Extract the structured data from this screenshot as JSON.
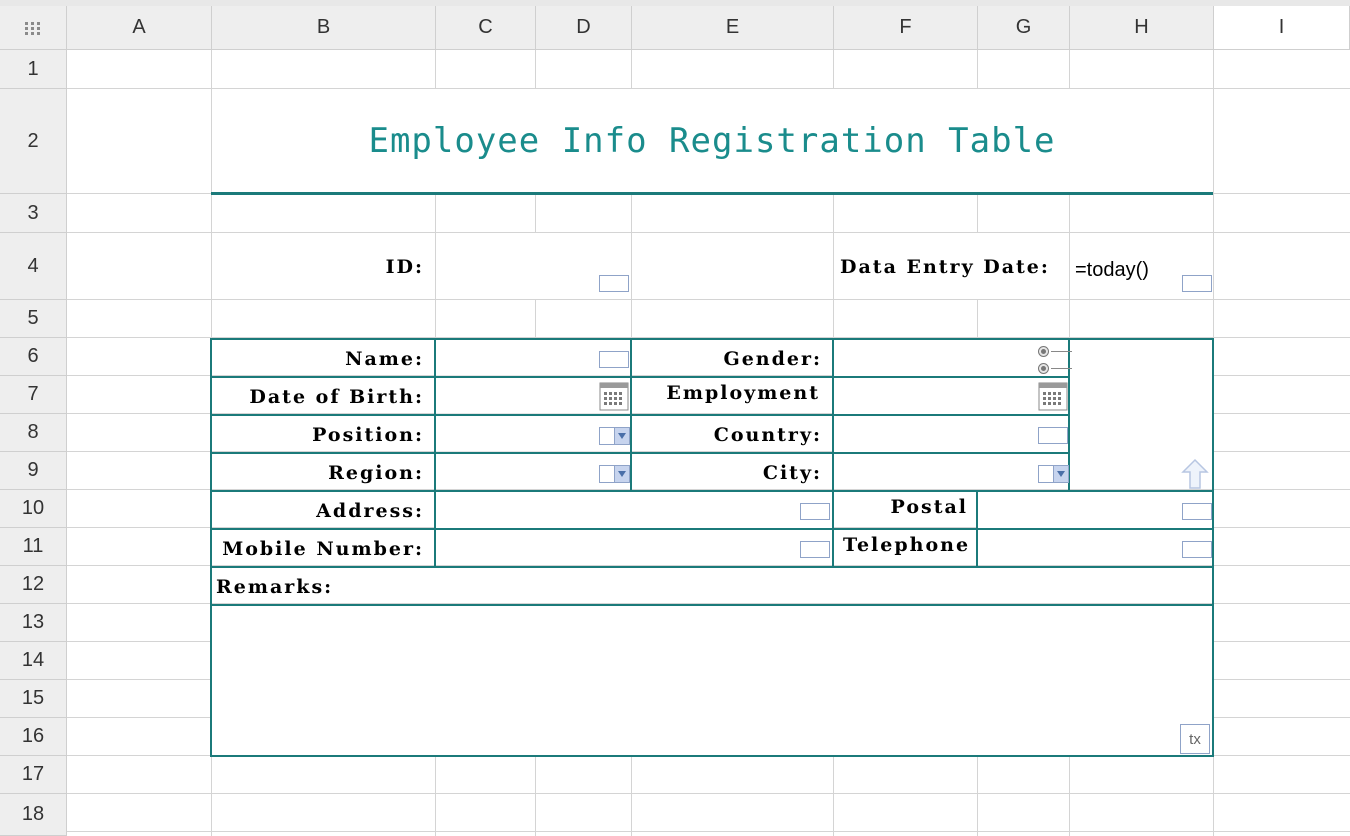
{
  "columns": [
    "A",
    "B",
    "C",
    "D",
    "E",
    "F",
    "G",
    "H",
    "I"
  ],
  "rows": [
    "1",
    "2",
    "3",
    "4",
    "5",
    "6",
    "7",
    "8",
    "9",
    "10",
    "11",
    "12",
    "13",
    "14",
    "15",
    "16",
    "17",
    "18"
  ],
  "form": {
    "title": "Employee Info Registration Table",
    "id_label": "ID:",
    "entry_date_label": "Data Entry Date:",
    "entry_date_value": "=today()",
    "name_label": "Name:",
    "gender_label": "Gender:",
    "dob_label": "Date of Birth:",
    "employment_label": "Employment",
    "position_label": "Position:",
    "country_label": "Country:",
    "region_label": "Region:",
    "city_label": "City:",
    "address_label": "Address:",
    "postal_label": "Postal",
    "mobile_label": "Mobile Number:",
    "telephone_label": "Telephone",
    "remarks_label": "Remarks:",
    "tx_label": "tx"
  },
  "colors": {
    "accent": "#1b7a7a",
    "title": "#1a8c8c",
    "widget_border": "#8fa3c8"
  }
}
